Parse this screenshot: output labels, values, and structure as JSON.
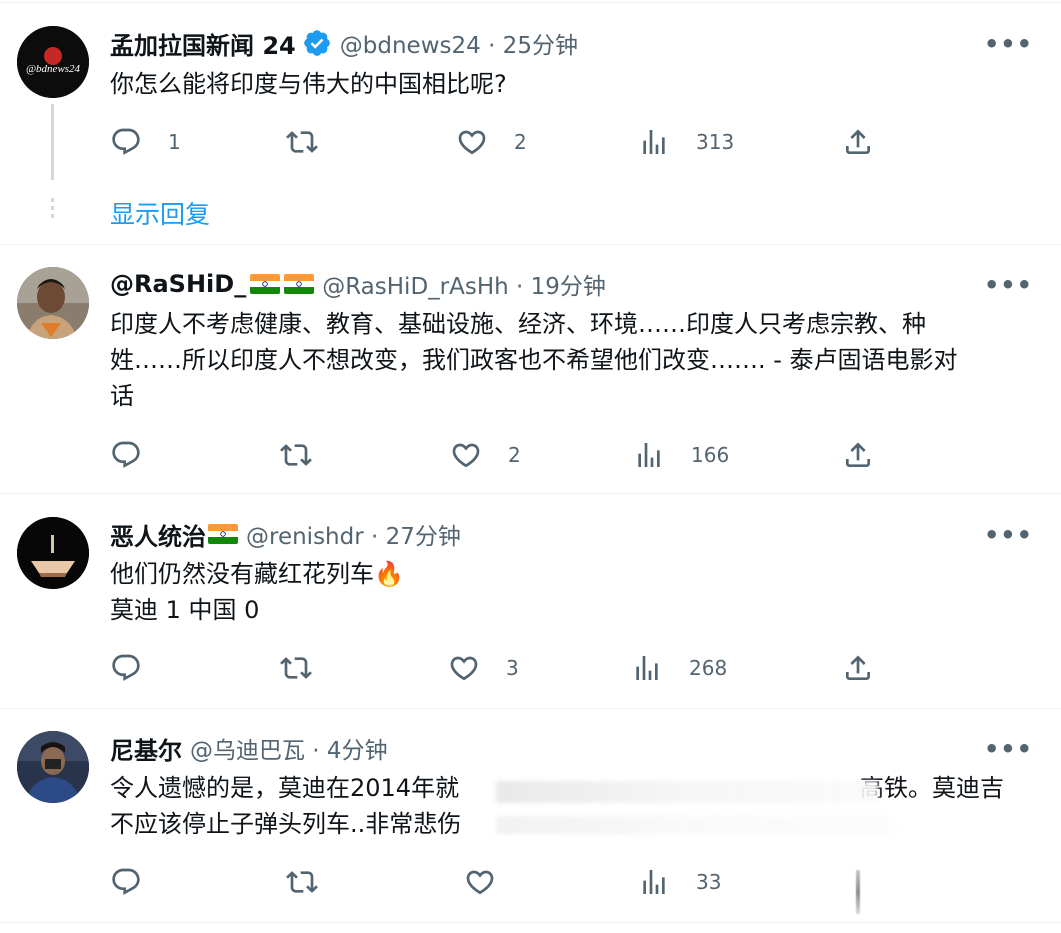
{
  "posts": [
    {
      "name": "孟加拉国新闻 24",
      "handle": "@bdnews24 · 25分钟",
      "avatar_text": "@bdnews24",
      "lines": [
        "你怎么能将印度与伟大的中国相比呢?"
      ],
      "replies": "1",
      "retweets": "",
      "likes": "2",
      "views": "313"
    },
    {
      "name": "@RaSHiD_",
      "handle": "@RasHiD_rAsHh · 19分钟",
      "lines": [
        "印度人不考虑健康、教育、基础设施、经济、环境……印度人只考虑宗教、种",
        "姓……所以印度人不想改变，我们政客也不希望他们改变……. - 泰卢固语电影对",
        "话"
      ],
      "replies": "",
      "retweets": "",
      "likes": "2",
      "views": "166"
    },
    {
      "name": "恶人统治",
      "handle": "@renishdr · 27分钟",
      "lines": [
        "他们仍然没有藏红花列车🔥",
        "莫迪 1 中国 0"
      ],
      "replies": "",
      "retweets": "",
      "likes": "3",
      "views": "268"
    },
    {
      "name": "尼基尔",
      "handle": "@乌迪巴瓦 · 4分钟",
      "line1_a": "令人遗憾的是，莫迪在2014年就",
      "line1_b": "高铁。莫迪吉",
      "line2": "不应该停止子弹头列车..非常悲伤",
      "replies": "",
      "retweets": "",
      "likes": "",
      "views": "33"
    }
  ],
  "show_replies": "显示回复",
  "more_label": "•••",
  "colors": {
    "accent": "#1d9bf0",
    "muted": "#536471",
    "verified": "#1d9bf0"
  }
}
